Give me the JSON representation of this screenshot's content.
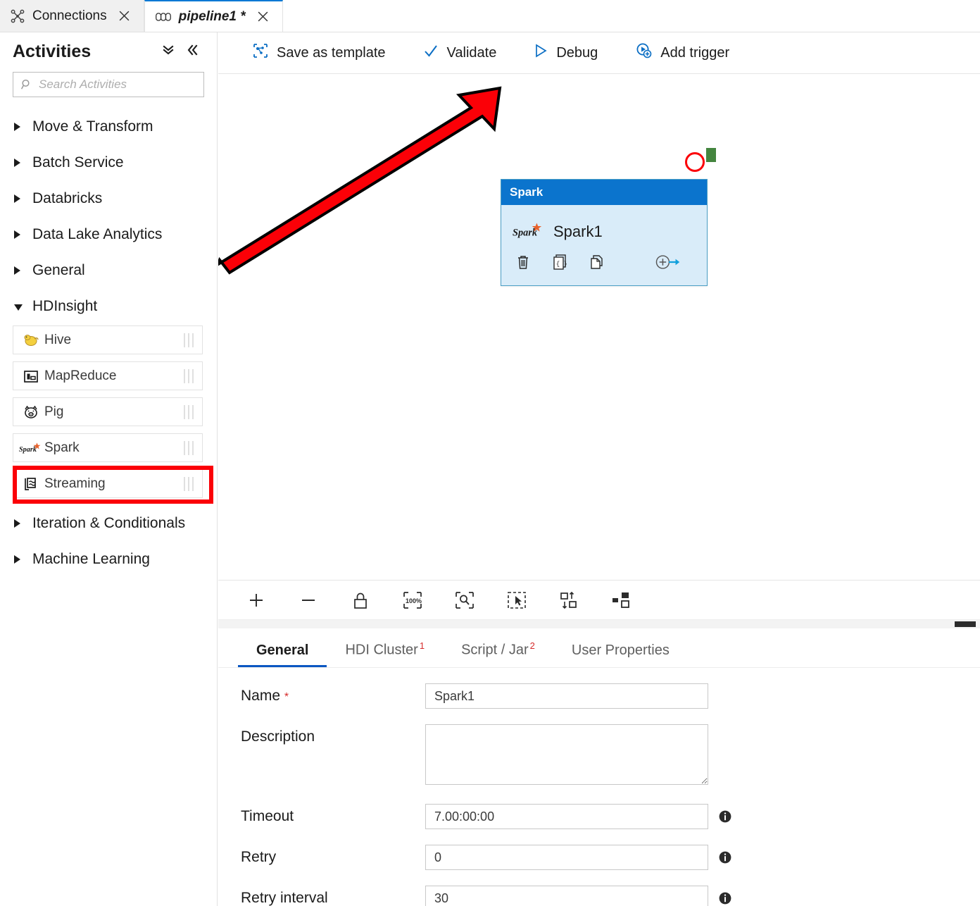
{
  "window": {
    "tabs": [
      {
        "label": "Connections",
        "icon": "connections-icon",
        "active": false,
        "dirty": false
      },
      {
        "label": "pipeline1 *",
        "icon": "pipeline-icon",
        "active": true,
        "dirty": true
      }
    ]
  },
  "sidebar": {
    "title": "Activities",
    "collapse_all_icon": "double-chevron-down-icon",
    "collapse_panel_icon": "double-chevron-left-icon",
    "search": {
      "placeholder": "Search Activities",
      "value": "",
      "icon": "search-icon"
    },
    "groups": [
      {
        "label": "Move & Transform",
        "expanded": false
      },
      {
        "label": "Batch Service",
        "expanded": false
      },
      {
        "label": "Databricks",
        "expanded": false
      },
      {
        "label": "Data Lake Analytics",
        "expanded": false
      },
      {
        "label": "General",
        "expanded": false
      },
      {
        "label": "HDInsight",
        "expanded": true
      },
      {
        "label": "Iteration & Conditionals",
        "expanded": false
      },
      {
        "label": "Machine Learning",
        "expanded": false
      }
    ],
    "hdinsight_activities": [
      {
        "label": "Hive",
        "icon": "hive-icon",
        "highlighted": false
      },
      {
        "label": "MapReduce",
        "icon": "mapreduce-icon",
        "highlighted": false
      },
      {
        "label": "Pig",
        "icon": "pig-icon",
        "highlighted": false
      },
      {
        "label": "Spark",
        "icon": "spark-icon",
        "highlighted": true
      },
      {
        "label": "Streaming",
        "icon": "streaming-icon",
        "highlighted": false
      }
    ]
  },
  "toolbar": {
    "save_as_template": "Save as template",
    "validate": "Validate",
    "debug": "Debug",
    "add_trigger": "Add trigger",
    "icons": {
      "save_as_template": "template-icon",
      "validate": "checkmark-icon",
      "debug": "play-icon",
      "add_trigger": "add-trigger-icon"
    }
  },
  "canvas": {
    "node": {
      "header": "Spark",
      "name": "Spark1",
      "icon": "spark-icon",
      "actions": [
        {
          "name": "delete",
          "icon": "trash-icon"
        },
        {
          "name": "code",
          "icon": "code-braces-icon"
        },
        {
          "name": "clone",
          "icon": "copy-icon"
        },
        {
          "name": "add-output",
          "icon": "add-output-arrow-icon"
        }
      ],
      "output_port_color": "#44853f"
    },
    "toolbar_icons": [
      {
        "name": "zoom-in",
        "icon": "plus-icon"
      },
      {
        "name": "zoom-out",
        "icon": "minus-icon"
      },
      {
        "name": "lock",
        "icon": "lock-icon"
      },
      {
        "name": "zoom-100",
        "icon": "zoom-100-icon",
        "label": "100%"
      },
      {
        "name": "zoom-to-fit",
        "icon": "zoom-fit-icon"
      },
      {
        "name": "select",
        "icon": "cursor-select-icon"
      },
      {
        "name": "auto-align",
        "icon": "auto-align-icon"
      },
      {
        "name": "auto-layout",
        "icon": "auto-layout-icon"
      }
    ]
  },
  "properties": {
    "tabs": [
      {
        "label": "General",
        "badge": "",
        "active": true
      },
      {
        "label": "HDI Cluster",
        "badge": "1",
        "active": false
      },
      {
        "label": "Script / Jar",
        "badge": "2",
        "active": false
      },
      {
        "label": "User Properties",
        "badge": "",
        "active": false
      }
    ],
    "fields": [
      {
        "label": "Name",
        "required": true,
        "value": "Spark1",
        "type": "text",
        "info": false
      },
      {
        "label": "Description",
        "required": false,
        "value": "",
        "type": "textarea",
        "info": false
      },
      {
        "label": "Timeout",
        "required": false,
        "value": "7.00:00:00",
        "type": "text",
        "info": true
      },
      {
        "label": "Retry",
        "required": false,
        "value": "0",
        "type": "text",
        "info": true
      },
      {
        "label": "Retry interval",
        "required": false,
        "value": "30",
        "type": "text",
        "info": true
      }
    ]
  },
  "annotations": {
    "arrow_color": "#fb0007",
    "arrow_outline_color": "#000000",
    "circle_color": "#fb0007",
    "rect_color": "#fb0007"
  }
}
